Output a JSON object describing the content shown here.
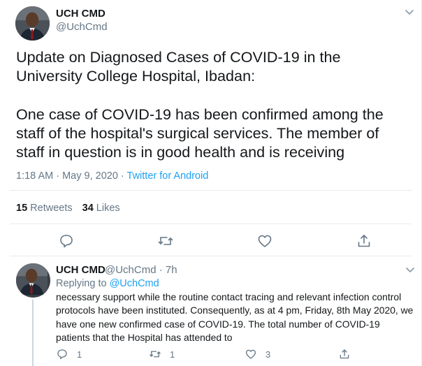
{
  "main_tweet": {
    "author_name": "UCH CMD",
    "author_handle": "@UchCmd",
    "text": "Update on Diagnosed Cases of COVID-19 in the University College Hospital, Ibadan:\n\nOne case of COVID-19 has been confirmed among the staff of the hospital's surgical services. The member of staff in question is in good health and is receiving",
    "timestamp": "1:18 AM · May 9, 2020 · ",
    "source": "Twitter for Android",
    "retweets_count": "15",
    "retweets_label": "Retweets",
    "likes_count": "34",
    "likes_label": "Likes",
    "icons": [
      "reply-icon",
      "retweet-icon",
      "like-icon",
      "share-icon",
      "chevron-down-icon"
    ]
  },
  "reply_tweet": {
    "author_name": "UCH CMD",
    "author_meta": "@UchCmd · 7h",
    "replying_prefix": "Replying to ",
    "replying_to": "@UchCmd",
    "text": "necessary support while the routine contact tracing and relevant infection control protocols have been instituted. Consequently, as at 4 pm, Friday, 8th May 2020, we have one new confirmed case of COVID-19. The total number of COVID-19 patients that the Hospital has attended to",
    "reply_count": "1",
    "retweet_count": "1",
    "like_count": "3"
  },
  "colors": {
    "accent": "#1da1f2",
    "text": "#14171a",
    "muted": "#657786",
    "divider": "#e6ecf0"
  }
}
